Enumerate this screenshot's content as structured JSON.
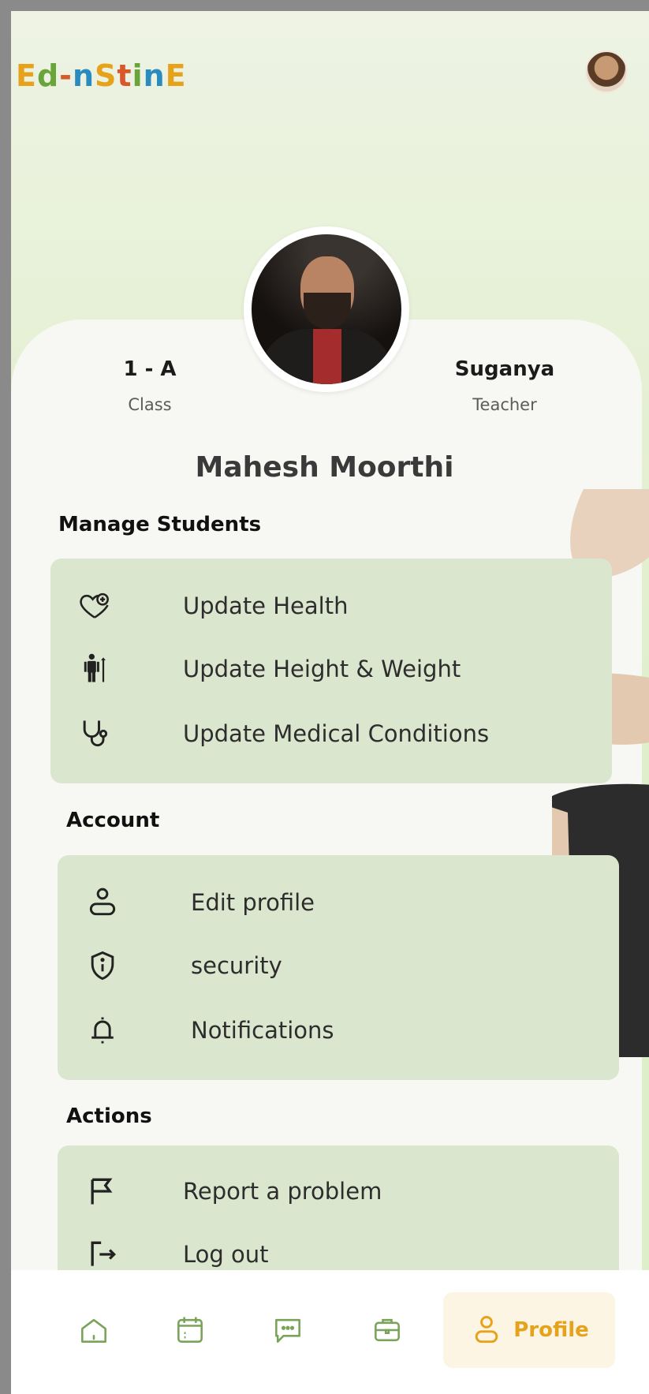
{
  "app": {
    "logo_text": "Ed-n-Stine",
    "logo_letters": [
      "E",
      "d",
      "-",
      "n",
      "S",
      "t",
      "i",
      "n",
      "E"
    ]
  },
  "profile": {
    "class_value": "1 - A",
    "class_label": "Class",
    "teacher_value": "Suganya",
    "teacher_label": "Teacher",
    "name": "Mahesh Moorthi"
  },
  "sections": {
    "manage": {
      "title": "Manage Students",
      "items": [
        {
          "label": "Update Health",
          "icon": "heart-plus-icon"
        },
        {
          "label": "Update Height & Weight",
          "icon": "height-weight-icon"
        },
        {
          "label": "Update Medical Conditions",
          "icon": "stethoscope-icon"
        }
      ]
    },
    "account": {
      "title": "Account",
      "items": [
        {
          "label": "Edit profile",
          "icon": "user-icon"
        },
        {
          "label": "security",
          "icon": "shield-info-icon"
        },
        {
          "label": "Notifications",
          "icon": "bell-icon"
        }
      ]
    },
    "actions": {
      "title": "Actions",
      "items": [
        {
          "label": "Report a problem",
          "icon": "flag-icon"
        },
        {
          "label": "Log out",
          "icon": "logout-icon"
        }
      ]
    }
  },
  "bottom_nav": {
    "items": [
      {
        "icon": "home-icon"
      },
      {
        "icon": "calendar-icon"
      },
      {
        "icon": "chat-icon"
      },
      {
        "icon": "briefcase-icon"
      },
      {
        "icon": "profile-icon",
        "label": "Profile",
        "active": true
      }
    ]
  },
  "colors": {
    "accent": "#e7a21b",
    "panel": "#dae6cd",
    "card": "#f7f8f3",
    "header_bg": "#e4f0d2"
  }
}
